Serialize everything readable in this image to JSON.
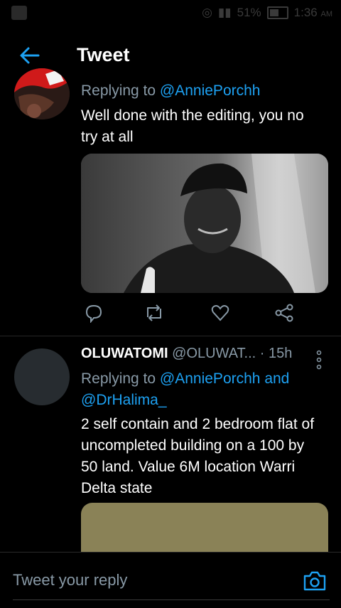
{
  "status": {
    "battery": "51%",
    "time": "1:36",
    "ampm": "AM"
  },
  "header": {
    "title": "Tweet"
  },
  "tweet1": {
    "replying_prefix": "Replying to ",
    "mention": "@AnniePorchh",
    "text_line1": "Well done with the editing, you no",
    "text_line2": "try at all"
  },
  "tweet2": {
    "name": "OLUWATOMI",
    "handle": "@OLUWAT...",
    "time": "· 15h",
    "replying_prefix": "Replying to ",
    "mention1": "@AnniePorchh",
    "and": " and",
    "mention2": "@DrHalima_",
    "text_line1": "2 self contain and 2 bedroom flat of",
    "text_line2": "uncompleted building on a 100 by",
    "text_line3": "50 land. Value 6M location  Warri",
    "text_line4": "Delta state"
  },
  "composer": {
    "placeholder": "Tweet your reply"
  },
  "colors": {
    "accent": "#1da1f2",
    "muted": "#8899a6"
  }
}
